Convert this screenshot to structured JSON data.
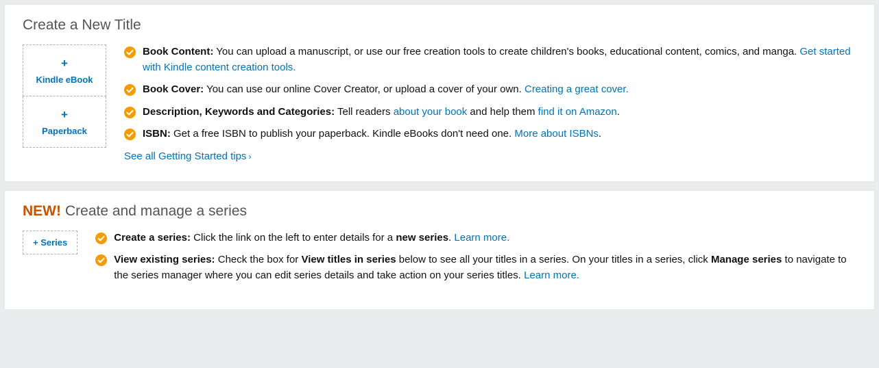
{
  "section1": {
    "title": "Create a New Title",
    "tile_ebook": "Kindle eBook",
    "tile_paperback": "Paperback",
    "plus_sign": "+",
    "items": {
      "book_content_label": "Book Content:",
      "book_content_text": " You can upload a manuscript, or use our free creation tools to create children's books, educational content, comics, and manga. ",
      "book_content_link": "Get started with Kindle content creation tools.",
      "book_cover_label": "Book Cover:",
      "book_cover_text": " You can use our online Cover Creator, or upload a cover of your own. ",
      "book_cover_link": "Creating a great cover.",
      "desc_label": "Description, Keywords and Categories:",
      "desc_text1": " Tell readers ",
      "desc_link1": "about your book",
      "desc_text2": " and help them ",
      "desc_link2": "find it on Amazon",
      "desc_period": ".",
      "isbn_label": "ISBN:",
      "isbn_text": " Get a free ISBN to publish your paperback. Kindle eBooks don't need one. ",
      "isbn_link": "More about ISBNs",
      "see_all": "See all Getting Started tips"
    }
  },
  "section2": {
    "new_badge": "NEW!",
    "title": "Create and manage a series",
    "tile_series": "+ Series",
    "items": {
      "create_label": "Create a series:",
      "create_text1": " Click the link on the left to enter details for a ",
      "create_bold": "new series",
      "create_period": ". ",
      "create_link": "Learn more.",
      "view_label": "View existing series:",
      "view_text1": " Check the box for ",
      "view_bold1": "View titles in series",
      "view_text2": " below to see all your titles in a series. On your titles in a series, click ",
      "view_bold2": "Manage series",
      "view_text3": " to navigate to the series manager where you can edit series details and take action on your series titles. ",
      "view_link": "Learn more."
    }
  }
}
